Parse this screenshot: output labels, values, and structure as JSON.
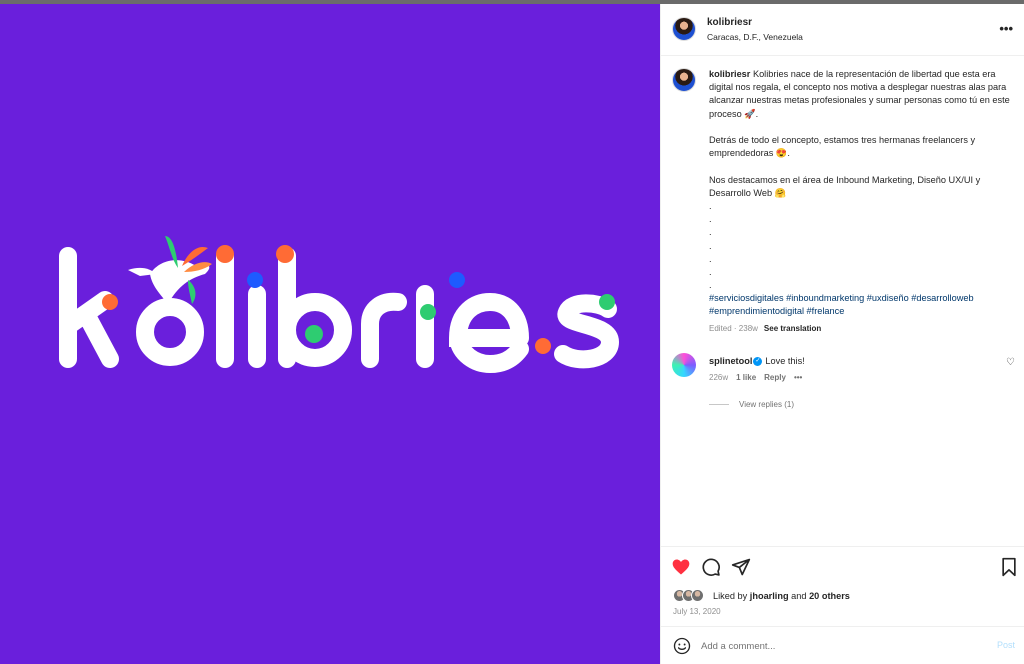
{
  "post": {
    "logo_text": "kolibries",
    "background_color": "#6a1fdc"
  },
  "header": {
    "username": "kolibriesr",
    "location": "Caracas, D.F., Venezuela",
    "more_icon": "more-horizontal-icon"
  },
  "caption": {
    "username": "kolibriesr",
    "paragraph1": "Kolibries nace de la representación de libertad que esta era digital nos regala, el concepto nos motiva a desplegar nuestras alas para alcanzar nuestras metas profesionales y sumar personas como tú en este proceso 🚀.",
    "paragraph2": "Detrás de todo el concepto, estamos tres hermanas freelancers y emprendedoras 😍.",
    "paragraph3": "Nos destacamos en el área de Inbound Marketing, Diseño UX/UI y Desarrollo Web 🤗",
    "dots": ".\n.\n.\n.\n.\n.\n.",
    "hashtags": "#serviciosdigitales #inboundmarketing #uxdiseño #desarrolloweb #emprendimientodigital #frelance",
    "edited": "Edited · 238w",
    "see_translation": "See translation"
  },
  "reply": {
    "username": "splinetool",
    "text": "Love this!",
    "time": "226w",
    "likes": "1 like",
    "reply_label": "Reply",
    "more": "•••",
    "view_replies": "View replies (1)"
  },
  "actions": {
    "liked_by_prefix": "Liked by",
    "liked_by_user": "jhoarling",
    "liked_by_and": "and",
    "liked_by_others": "20 others",
    "date": "July 13, 2020",
    "like_color": "#ff3040"
  },
  "comment_box": {
    "placeholder": "Add a comment...",
    "post_label": "Post"
  }
}
